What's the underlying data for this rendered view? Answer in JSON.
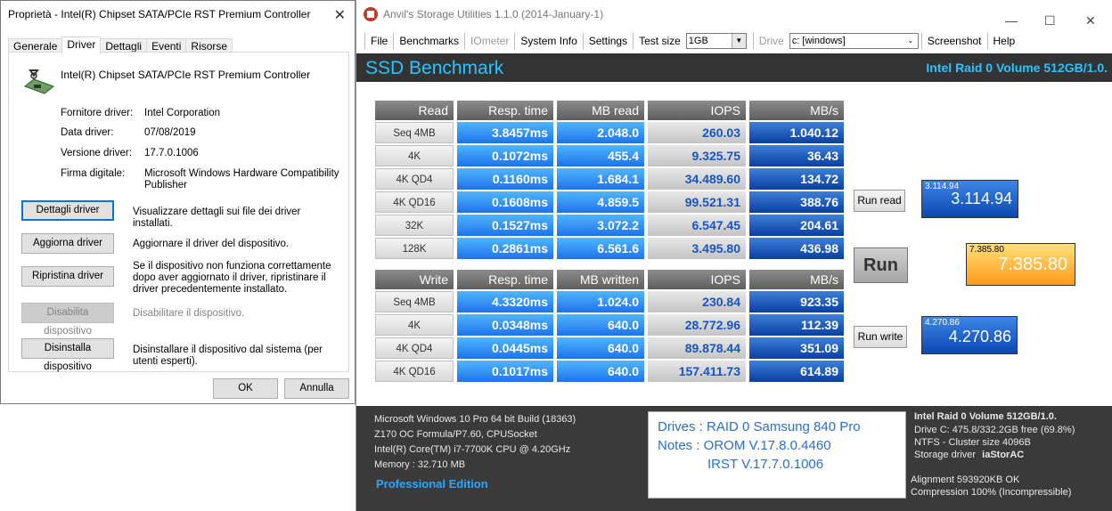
{
  "properties_window": {
    "title": "Proprietà - Intel(R) Chipset SATA/PCIe RST Premium Controller",
    "tabs": [
      "Generale",
      "Driver",
      "Dettagli",
      "Eventi",
      "Risorse"
    ],
    "active_tab": "Driver",
    "device_name": "Intel(R) Chipset SATA/PCIe RST Premium Controller",
    "fields": [
      {
        "label": "Fornitore driver:",
        "value": "Intel Corporation"
      },
      {
        "label": "Data driver:",
        "value": "07/08/2019"
      },
      {
        "label": "Versione driver:",
        "value": "17.7.0.1006"
      },
      {
        "label": "Firma digitale:",
        "value": "Microsoft Windows Hardware Compatibility Publisher"
      }
    ],
    "buttons": [
      {
        "label": "Dettagli driver",
        "desc": "Visualizzare dettagli sui file dei driver installati."
      },
      {
        "label": "Aggiorna driver",
        "desc": "Aggiornare il driver del dispositivo."
      },
      {
        "label": "Ripristina driver",
        "desc": "Se il dispositivo non funziona correttamente dopo aver aggiornato il driver, ripristinare il driver precedentemente installato."
      },
      {
        "label": "Disabilita dispositivo",
        "desc": "Disabilitare il dispositivo."
      },
      {
        "label": "Disinstalla dispositivo",
        "desc": "Disinstallare il dispositivo dal sistema (per utenti esperti)."
      }
    ],
    "ok": "OK",
    "cancel": "Annulla"
  },
  "anvil": {
    "title": "Anvil's Storage Utilities 1.1.0 (2014-January-1)",
    "menu": [
      "File",
      "Benchmarks",
      "IOmeter",
      "System Info",
      "Settings",
      "Test size"
    ],
    "test_size": "1GB",
    "drive_label": "Drive",
    "drive_value": "c: [windows]",
    "screenshot": "Screenshot",
    "help": "Help",
    "header_title": "SSD Benchmark",
    "header_drive": "Intel Raid 0 Volume 512GB/1.0.",
    "read_headers": [
      "Read",
      "Resp. time",
      "MB read",
      "IOPS",
      "MB/s"
    ],
    "read_rows": [
      [
        "Seq 4MB",
        "3.8457ms",
        "2.048.0",
        "260.03",
        "1.040.12"
      ],
      [
        "4K",
        "0.1072ms",
        "455.4",
        "9.325.75",
        "36.43"
      ],
      [
        "4K QD4",
        "0.1160ms",
        "1.684.1",
        "34.489.60",
        "134.72"
      ],
      [
        "4K QD16",
        "0.1608ms",
        "4.859.5",
        "99.521.31",
        "388.76"
      ],
      [
        "32K",
        "0.1527ms",
        "3.072.2",
        "6.547.45",
        "204.61"
      ],
      [
        "128K",
        "0.2861ms",
        "6.561.6",
        "3.495.80",
        "436.98"
      ]
    ],
    "write_headers": [
      "Write",
      "Resp. time",
      "MB written",
      "IOPS",
      "MB/s"
    ],
    "write_rows": [
      [
        "Seq 4MB",
        "4.3320ms",
        "1.024.0",
        "230.84",
        "923.35"
      ],
      [
        "4K",
        "0.0348ms",
        "640.0",
        "28.772.96",
        "112.39"
      ],
      [
        "4K QD4",
        "0.0445ms",
        "640.0",
        "89.878.44",
        "351.09"
      ],
      [
        "4K QD16",
        "0.1017ms",
        "640.0",
        "157.411.73",
        "614.89"
      ]
    ],
    "run_read": "Run read",
    "run": "Run",
    "run_write": "Run write",
    "read_score_small": "3.114.94",
    "read_score": "3.114.94",
    "total_score_small": "7.385.80",
    "total_score": "7.385.80",
    "write_score_small": "4.270.86",
    "write_score": "4.270.86",
    "sysinfo": [
      "Microsoft Windows 10 Pro 64 bit Build (18363)",
      "Z170 OC Formula/P7.60, CPUSocket",
      "Intel(R) Core(TM) i7-7700K CPU @ 4.20GHz",
      "Memory : 32.710 MB"
    ],
    "edition": "Professional Edition",
    "notes": [
      "Drives : RAID 0 Samsung 840 Pro",
      "Notes : OROM V.17.8.0.4460",
      "IRST V.17.7.0.1006"
    ],
    "drive_info_title": "Intel Raid 0 Volume 512GB/1.0.",
    "drive_info": [
      "Drive C: 475.8/332.2GB free (69.8%)",
      "NTFS - Cluster size 4096B",
      "Storage driver"
    ],
    "storage_driver": "iaStorAC",
    "alignment": "Alignment 593920KB OK",
    "compression": "Compression 100% (Incompressible)",
    "colors": {
      "header_bg": "#333333",
      "accent": "#2ac3ff",
      "total": "#ffb020"
    }
  }
}
